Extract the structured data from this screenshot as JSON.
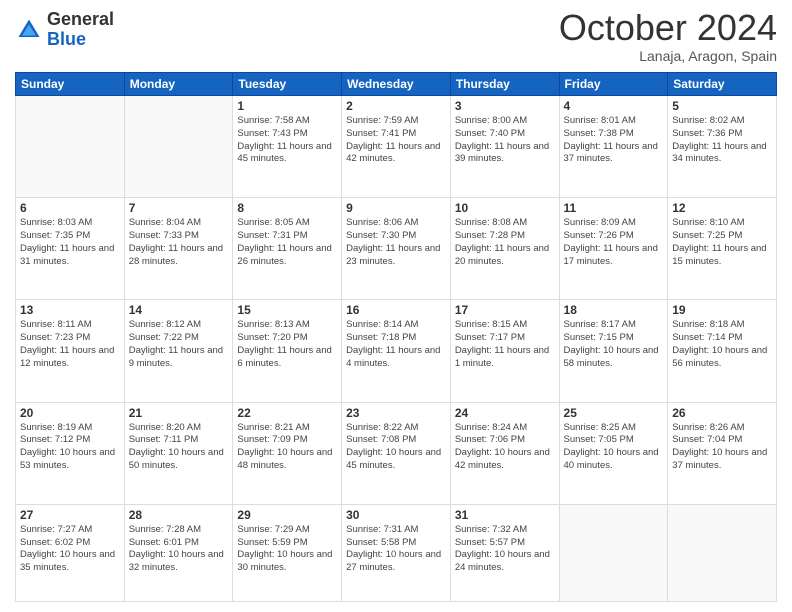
{
  "header": {
    "logo_general": "General",
    "logo_blue": "Blue",
    "month_title": "October 2024",
    "location": "Lanaja, Aragon, Spain"
  },
  "days_of_week": [
    "Sunday",
    "Monday",
    "Tuesday",
    "Wednesday",
    "Thursday",
    "Friday",
    "Saturday"
  ],
  "weeks": [
    [
      {
        "day": "",
        "info": ""
      },
      {
        "day": "",
        "info": ""
      },
      {
        "day": "1",
        "info": "Sunrise: 7:58 AM\nSunset: 7:43 PM\nDaylight: 11 hours and 45 minutes."
      },
      {
        "day": "2",
        "info": "Sunrise: 7:59 AM\nSunset: 7:41 PM\nDaylight: 11 hours and 42 minutes."
      },
      {
        "day": "3",
        "info": "Sunrise: 8:00 AM\nSunset: 7:40 PM\nDaylight: 11 hours and 39 minutes."
      },
      {
        "day": "4",
        "info": "Sunrise: 8:01 AM\nSunset: 7:38 PM\nDaylight: 11 hours and 37 minutes."
      },
      {
        "day": "5",
        "info": "Sunrise: 8:02 AM\nSunset: 7:36 PM\nDaylight: 11 hours and 34 minutes."
      }
    ],
    [
      {
        "day": "6",
        "info": "Sunrise: 8:03 AM\nSunset: 7:35 PM\nDaylight: 11 hours and 31 minutes."
      },
      {
        "day": "7",
        "info": "Sunrise: 8:04 AM\nSunset: 7:33 PM\nDaylight: 11 hours and 28 minutes."
      },
      {
        "day": "8",
        "info": "Sunrise: 8:05 AM\nSunset: 7:31 PM\nDaylight: 11 hours and 26 minutes."
      },
      {
        "day": "9",
        "info": "Sunrise: 8:06 AM\nSunset: 7:30 PM\nDaylight: 11 hours and 23 minutes."
      },
      {
        "day": "10",
        "info": "Sunrise: 8:08 AM\nSunset: 7:28 PM\nDaylight: 11 hours and 20 minutes."
      },
      {
        "day": "11",
        "info": "Sunrise: 8:09 AM\nSunset: 7:26 PM\nDaylight: 11 hours and 17 minutes."
      },
      {
        "day": "12",
        "info": "Sunrise: 8:10 AM\nSunset: 7:25 PM\nDaylight: 11 hours and 15 minutes."
      }
    ],
    [
      {
        "day": "13",
        "info": "Sunrise: 8:11 AM\nSunset: 7:23 PM\nDaylight: 11 hours and 12 minutes."
      },
      {
        "day": "14",
        "info": "Sunrise: 8:12 AM\nSunset: 7:22 PM\nDaylight: 11 hours and 9 minutes."
      },
      {
        "day": "15",
        "info": "Sunrise: 8:13 AM\nSunset: 7:20 PM\nDaylight: 11 hours and 6 minutes."
      },
      {
        "day": "16",
        "info": "Sunrise: 8:14 AM\nSunset: 7:18 PM\nDaylight: 11 hours and 4 minutes."
      },
      {
        "day": "17",
        "info": "Sunrise: 8:15 AM\nSunset: 7:17 PM\nDaylight: 11 hours and 1 minute."
      },
      {
        "day": "18",
        "info": "Sunrise: 8:17 AM\nSunset: 7:15 PM\nDaylight: 10 hours and 58 minutes."
      },
      {
        "day": "19",
        "info": "Sunrise: 8:18 AM\nSunset: 7:14 PM\nDaylight: 10 hours and 56 minutes."
      }
    ],
    [
      {
        "day": "20",
        "info": "Sunrise: 8:19 AM\nSunset: 7:12 PM\nDaylight: 10 hours and 53 minutes."
      },
      {
        "day": "21",
        "info": "Sunrise: 8:20 AM\nSunset: 7:11 PM\nDaylight: 10 hours and 50 minutes."
      },
      {
        "day": "22",
        "info": "Sunrise: 8:21 AM\nSunset: 7:09 PM\nDaylight: 10 hours and 48 minutes."
      },
      {
        "day": "23",
        "info": "Sunrise: 8:22 AM\nSunset: 7:08 PM\nDaylight: 10 hours and 45 minutes."
      },
      {
        "day": "24",
        "info": "Sunrise: 8:24 AM\nSunset: 7:06 PM\nDaylight: 10 hours and 42 minutes."
      },
      {
        "day": "25",
        "info": "Sunrise: 8:25 AM\nSunset: 7:05 PM\nDaylight: 10 hours and 40 minutes."
      },
      {
        "day": "26",
        "info": "Sunrise: 8:26 AM\nSunset: 7:04 PM\nDaylight: 10 hours and 37 minutes."
      }
    ],
    [
      {
        "day": "27",
        "info": "Sunrise: 7:27 AM\nSunset: 6:02 PM\nDaylight: 10 hours and 35 minutes."
      },
      {
        "day": "28",
        "info": "Sunrise: 7:28 AM\nSunset: 6:01 PM\nDaylight: 10 hours and 32 minutes."
      },
      {
        "day": "29",
        "info": "Sunrise: 7:29 AM\nSunset: 5:59 PM\nDaylight: 10 hours and 30 minutes."
      },
      {
        "day": "30",
        "info": "Sunrise: 7:31 AM\nSunset: 5:58 PM\nDaylight: 10 hours and 27 minutes."
      },
      {
        "day": "31",
        "info": "Sunrise: 7:32 AM\nSunset: 5:57 PM\nDaylight: 10 hours and 24 minutes."
      },
      {
        "day": "",
        "info": ""
      },
      {
        "day": "",
        "info": ""
      }
    ]
  ]
}
